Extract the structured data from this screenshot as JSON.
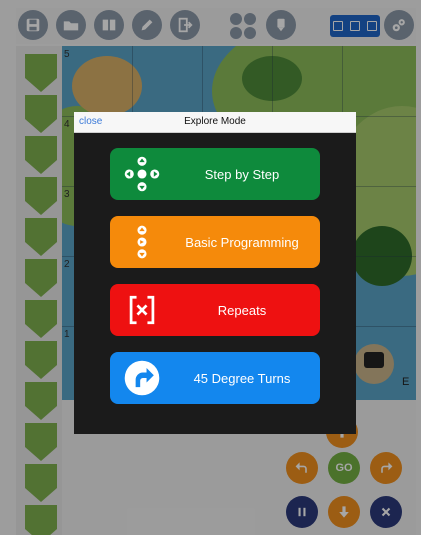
{
  "toolbar": {
    "icons": [
      "save-icon",
      "folder-icon",
      "book-icon",
      "pencil-icon",
      "exit-icon",
      "grid-icon",
      "badge-icon",
      "mode-icon",
      "gear-icon"
    ]
  },
  "map": {
    "row_labels": [
      "5",
      "4",
      "3",
      "2",
      "1"
    ],
    "corner_text": "E"
  },
  "controls": {
    "go_label": "GO"
  },
  "modal": {
    "close_label": "close",
    "title": "Explore Mode",
    "modes": [
      {
        "label": "Step by Step",
        "color": "#0e8a3c",
        "icon": "four-arrows-icon"
      },
      {
        "label": "Basic Programming",
        "color": "#f58a0b",
        "icon": "program-icon"
      },
      {
        "label": "Repeats",
        "color": "#ee1111",
        "icon": "repeat-bracket-icon"
      },
      {
        "label": "45 Degree Turns",
        "color": "#1387ee",
        "icon": "turn-arrow-icon"
      }
    ]
  },
  "colors": {
    "toolbar_icon": "#8b98a8",
    "sidebar_arrow": "#7fb04f",
    "control_orange": "#f08f1e",
    "control_green": "#73b043",
    "control_navy": "#2b3a7c"
  }
}
